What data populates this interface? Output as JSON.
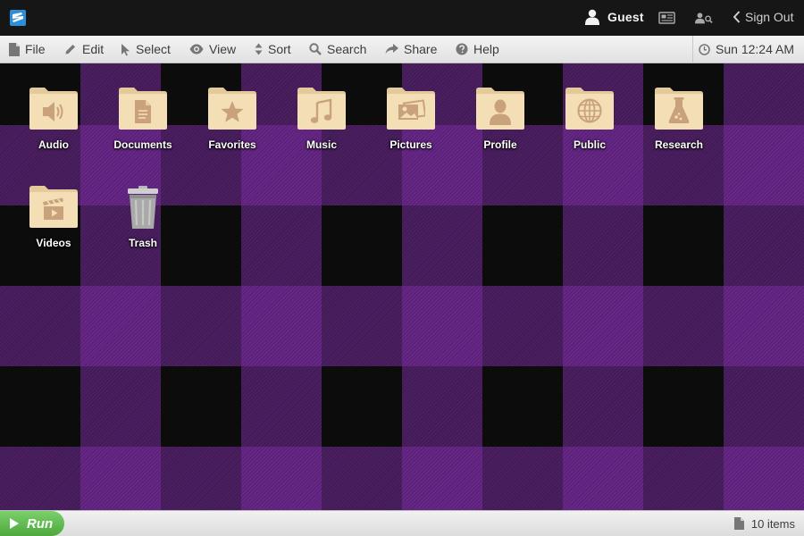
{
  "header": {
    "user_name": "Guest",
    "sign_out_label": "Sign Out"
  },
  "menu": {
    "items": [
      {
        "label": "File",
        "icon": "file-icon"
      },
      {
        "label": "Edit",
        "icon": "pencil-icon"
      },
      {
        "label": "Select",
        "icon": "cursor-icon"
      },
      {
        "label": "View",
        "icon": "eye-icon"
      },
      {
        "label": "Sort",
        "icon": "sort-icon"
      },
      {
        "label": "Search",
        "icon": "search-icon"
      },
      {
        "label": "Share",
        "icon": "share-icon"
      },
      {
        "label": "Help",
        "icon": "help-icon"
      }
    ],
    "clock": "Sun 12:24 AM"
  },
  "desktop": {
    "items": [
      {
        "label": "Audio",
        "icon": "speaker-icon"
      },
      {
        "label": "Documents",
        "icon": "document-icon"
      },
      {
        "label": "Favorites",
        "icon": "star-icon"
      },
      {
        "label": "Music",
        "icon": "music-note-icon"
      },
      {
        "label": "Pictures",
        "icon": "picture-icon"
      },
      {
        "label": "Profile",
        "icon": "person-icon"
      },
      {
        "label": "Public",
        "icon": "globe-icon"
      },
      {
        "label": "Research",
        "icon": "flask-icon"
      },
      {
        "label": "Videos",
        "icon": "clapperboard-icon"
      },
      {
        "label": "Trash",
        "icon": "trash-icon"
      }
    ]
  },
  "status": {
    "run_label": "Run",
    "item_count": "10 items"
  },
  "colors": {
    "topbar_bg": "#161616",
    "plaid_purple": "#7d2da5",
    "folder": "#f3deb6",
    "folder_glyph": "#c9a27c",
    "run_green": "#5cb84a"
  }
}
